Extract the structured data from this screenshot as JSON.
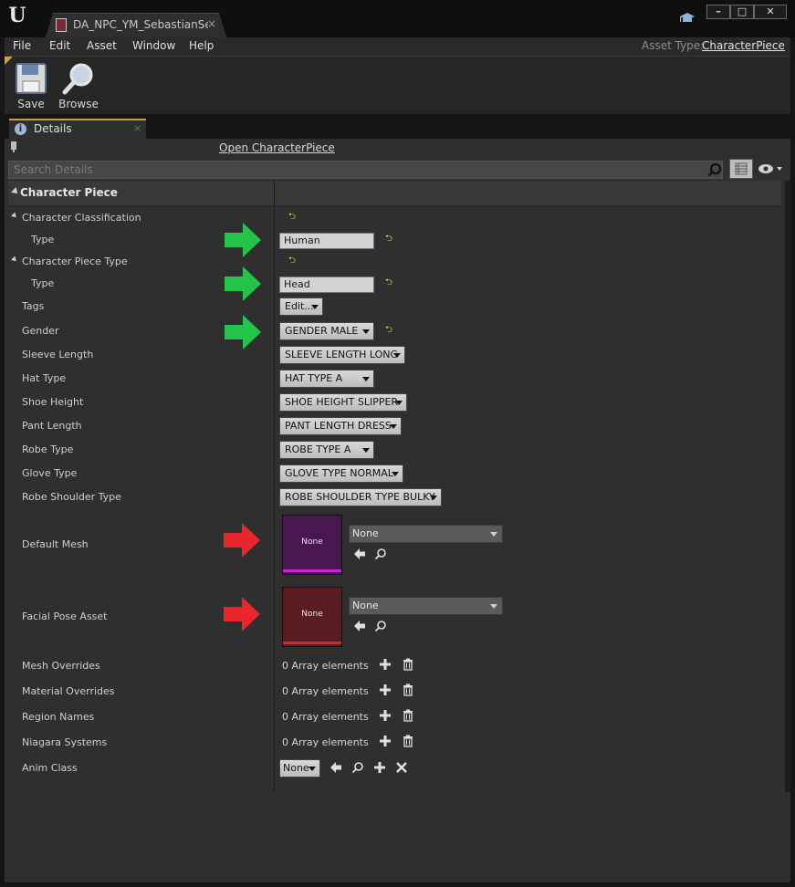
{
  "window": {
    "tab_title": "DA_NPC_YM_SebastianSe",
    "tab_close": "×",
    "minimize": "–",
    "maximize": "□",
    "close": "✕"
  },
  "menu": {
    "items": [
      "File",
      "Edit",
      "Asset",
      "Window",
      "Help"
    ],
    "asset_type_label": "Asset Type:",
    "asset_type_value": "CharacterPiece"
  },
  "toolbar": {
    "save_label": "Save",
    "browse_label": "Browse"
  },
  "details_tab": {
    "label": "Details",
    "close": "×"
  },
  "panel": {
    "open_link": "Open CharacterPiece",
    "search_placeholder": "Search Details",
    "category": "Character Piece"
  },
  "properties": {
    "character_classification": {
      "label": "Character Classification",
      "type_label": "Type",
      "type_value": "Human"
    },
    "character_piece_type": {
      "label": "Character Piece Type",
      "type_label": "Type",
      "type_value": "Head"
    },
    "tags": {
      "label": "Tags",
      "value": "Edit..."
    },
    "gender": {
      "label": "Gender",
      "value": "GENDER MALE"
    },
    "sleeve_length": {
      "label": "Sleeve Length",
      "value": "SLEEVE LENGTH LONG"
    },
    "hat_type": {
      "label": "Hat Type",
      "value": "HAT TYPE A"
    },
    "shoe_height": {
      "label": "Shoe Height",
      "value": "SHOE HEIGHT SLIPPER"
    },
    "pant_length": {
      "label": "Pant Length",
      "value": "PANT LENGTH DRESS"
    },
    "robe_type": {
      "label": "Robe Type",
      "value": "ROBE TYPE A"
    },
    "glove_type": {
      "label": "Glove Type",
      "value": "GLOVE TYPE NORMAL"
    },
    "robe_shoulder_type": {
      "label": "Robe Shoulder Type",
      "value": "ROBE SHOULDER TYPE BULKY"
    },
    "default_mesh": {
      "label": "Default Mesh",
      "thumb_text": "None",
      "value": "None"
    },
    "facial_pose_asset": {
      "label": "Facial Pose Asset",
      "thumb_text": "None",
      "value": "None"
    },
    "mesh_overrides": {
      "label": "Mesh Overrides",
      "value": "0 Array elements"
    },
    "material_overrides": {
      "label": "Material Overrides",
      "value": "0 Array elements"
    },
    "region_names": {
      "label": "Region Names",
      "value": "0 Array elements"
    },
    "niagara_systems": {
      "label": "Niagara Systems",
      "value": "0 Array elements"
    },
    "anim_class": {
      "label": "Anim Class",
      "value": "None"
    }
  },
  "colors": {
    "arrow_green": "#22c54a",
    "arrow_red": "#e8262b",
    "mesh_thumb": "#4a1650",
    "mesh_bar": "#c826d6",
    "pose_thumb": "#5a1c20",
    "pose_bar": "#d22a2a"
  },
  "icons": {
    "reset": "reset-to-default-icon",
    "search": "search-icon",
    "eye": "eye-icon"
  }
}
